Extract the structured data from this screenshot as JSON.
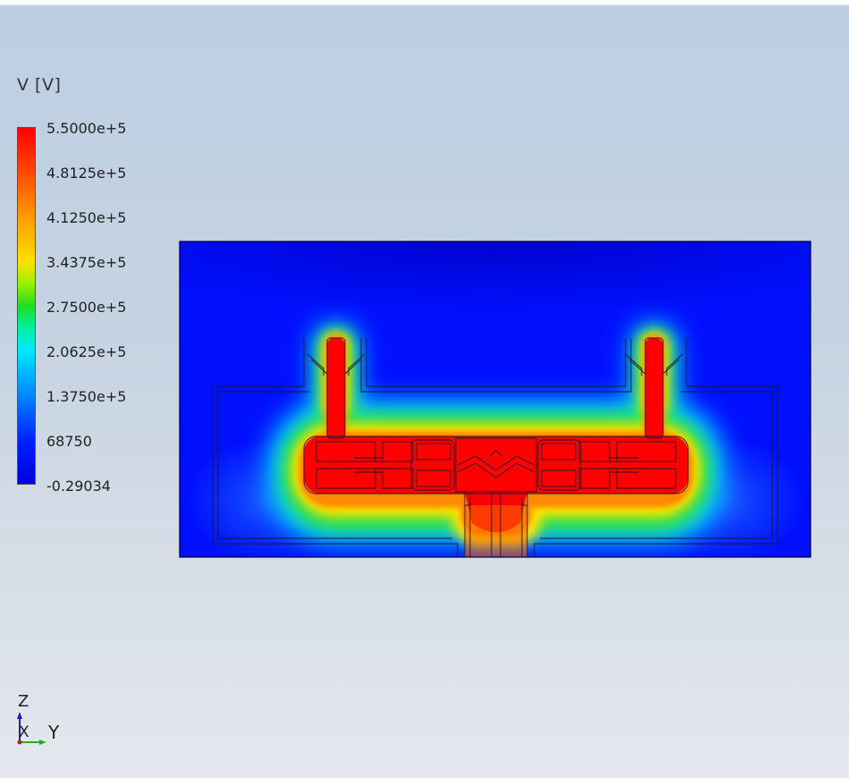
{
  "legend": {
    "title": "V [V]",
    "ticks": [
      "5.5000e+5",
      "4.8125e+5",
      "4.1250e+5",
      "3.4375e+5",
      "2.7500e+5",
      "2.0625e+5",
      "1.3750e+5",
      "68750",
      "-0.29034"
    ],
    "max": 550000,
    "min": -0.29034,
    "colormap": [
      "#0000e0",
      "#0022ff",
      "#0088ff",
      "#00e8ff",
      "#00f0a0",
      "#22dd22",
      "#9af000",
      "#ffe000",
      "#ff9a00",
      "#ff4a00",
      "#ff0000"
    ]
  },
  "triad": {
    "z_label": "Z",
    "x_label": "X",
    "y_label": "Y",
    "z_color": "#2020b0",
    "y_color": "#20b020",
    "x_color": "#b02020"
  },
  "colors": {
    "background_top": "#bccfe3",
    "background_bottom": "#e4e8ee",
    "domain_low": "#0000e6",
    "domain_high": "#ff0000"
  }
}
